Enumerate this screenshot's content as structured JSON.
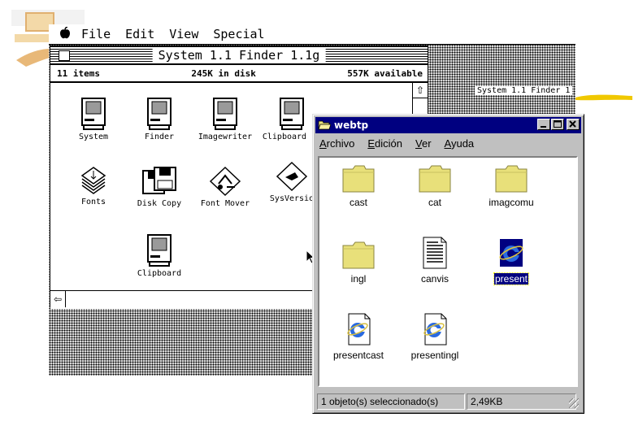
{
  "mac": {
    "menu": [
      "File",
      "Edit",
      "View",
      "Special"
    ],
    "finder": {
      "title": "System 1.1 Finder 1.1g",
      "items_count": "11 items",
      "disk_used": "245K in disk",
      "available": "557K available",
      "icons": [
        {
          "label": "System",
          "icon": "mac-computer-icon"
        },
        {
          "label": "Finder",
          "icon": "mac-computer-icon"
        },
        {
          "label": "Imagewriter",
          "icon": "mac-computer-icon"
        },
        {
          "label": "Clipboard Fi",
          "icon": "mac-computer-icon"
        },
        {
          "label": "Fonts",
          "icon": "fonts-icon"
        },
        {
          "label": "Disk Copy",
          "icon": "disk-copy-icon"
        },
        {
          "label": "Font Mover",
          "icon": "font-mover-icon"
        },
        {
          "label": "SysVersio",
          "icon": "sysversion-icon"
        },
        {
          "label": "Clipboard",
          "icon": "mac-computer-icon"
        }
      ]
    },
    "desktop_label": "System 1.1 Finder 1"
  },
  "win": {
    "title": "webtp",
    "menu": [
      {
        "accel": "A",
        "rest": "rchivo"
      },
      {
        "accel": "E",
        "rest": "dición"
      },
      {
        "accel": "V",
        "rest": "er"
      },
      {
        "accel": "A",
        "rest": "yuda"
      }
    ],
    "items": [
      {
        "label": "cast",
        "type": "folder",
        "selected": false
      },
      {
        "label": "cat",
        "type": "folder",
        "selected": false
      },
      {
        "label": "imagcomu",
        "type": "folder",
        "selected": false
      },
      {
        "label": "ingl",
        "type": "folder",
        "selected": false
      },
      {
        "label": "canvis",
        "type": "document",
        "selected": false
      },
      {
        "label": "present",
        "type": "ie-shortcut",
        "selected": true
      },
      {
        "label": "presentcast",
        "type": "ie-document",
        "selected": false
      },
      {
        "label": "presentingl",
        "type": "ie-document",
        "selected": false
      }
    ],
    "status": {
      "selection": "1 objeto(s) seleccionado(s)",
      "size": "2,49KB"
    }
  },
  "colors": {
    "win_title": "#000080",
    "folder": "#e8e07a",
    "highlight_stroke": "#f0c800"
  }
}
